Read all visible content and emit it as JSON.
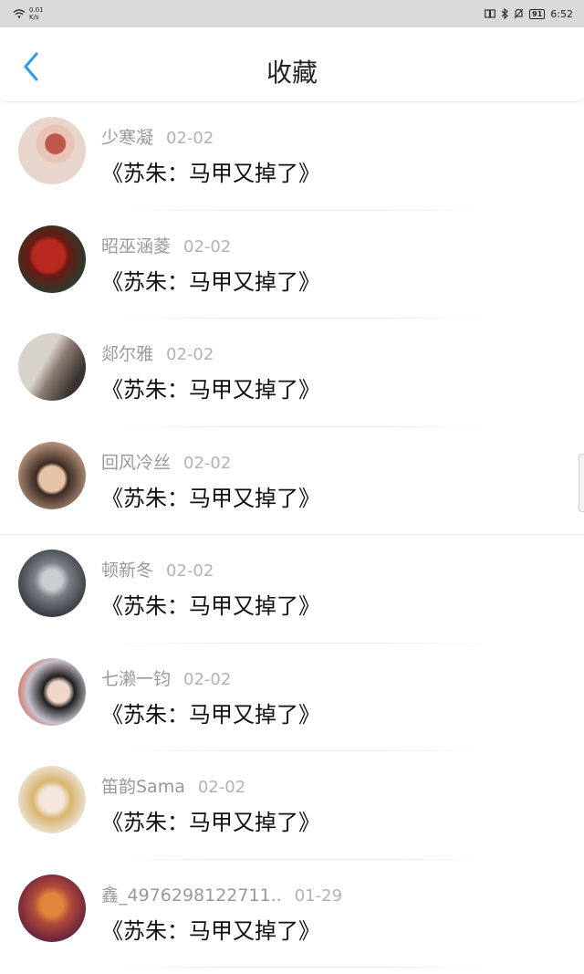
{
  "status_bar": {
    "speed_value": "0.01",
    "speed_unit": "K/s",
    "battery": "91",
    "time": "6:52"
  },
  "header": {
    "title": "收藏",
    "back_icon": "chevron-left-icon",
    "accent_color": "#2a9bf2"
  },
  "favorites": [
    {
      "name": "少寒凝",
      "date": "02-02",
      "title": "《苏朱：马甲又掉了》",
      "avatar_colors": [
        "#e8d6cc",
        "#c0574b"
      ]
    },
    {
      "name": "昭巫涵菱",
      "date": "02-02",
      "title": "《苏朱：马甲又掉了》",
      "avatar_colors": [
        "#2c3a2a",
        "#b8291f"
      ]
    },
    {
      "name": "郯尔雅",
      "date": "02-02",
      "title": "《苏朱：马甲又掉了》",
      "avatar_colors": [
        "#d8d2cc",
        "#3a3330"
      ]
    },
    {
      "name": "回风冷丝",
      "date": "02-02",
      "title": "《苏朱：马甲又掉了》",
      "avatar_colors": [
        "#c9a48a",
        "#3b2a22"
      ]
    },
    {
      "name": "顿新冬",
      "date": "02-02",
      "title": "《苏朱：马甲又掉了》",
      "avatar_colors": [
        "#3c4148",
        "#c8cdd2"
      ]
    },
    {
      "name": "七濑一钧",
      "date": "02-02",
      "title": "《苏朱：马甲又掉了》",
      "avatar_colors": [
        "#c8c2cc",
        "#1f1f1f"
      ]
    },
    {
      "name": "笛韵Sama",
      "date": "02-02",
      "title": "《苏朱：马甲又掉了》",
      "avatar_colors": [
        "#ede4d8",
        "#d8b46e"
      ]
    },
    {
      "name": "鑫_4976298122711..",
      "date": "01-29",
      "title": "《苏朱：马甲又掉了》",
      "avatar_colors": [
        "#7a2b3c",
        "#e0853c"
      ]
    }
  ]
}
